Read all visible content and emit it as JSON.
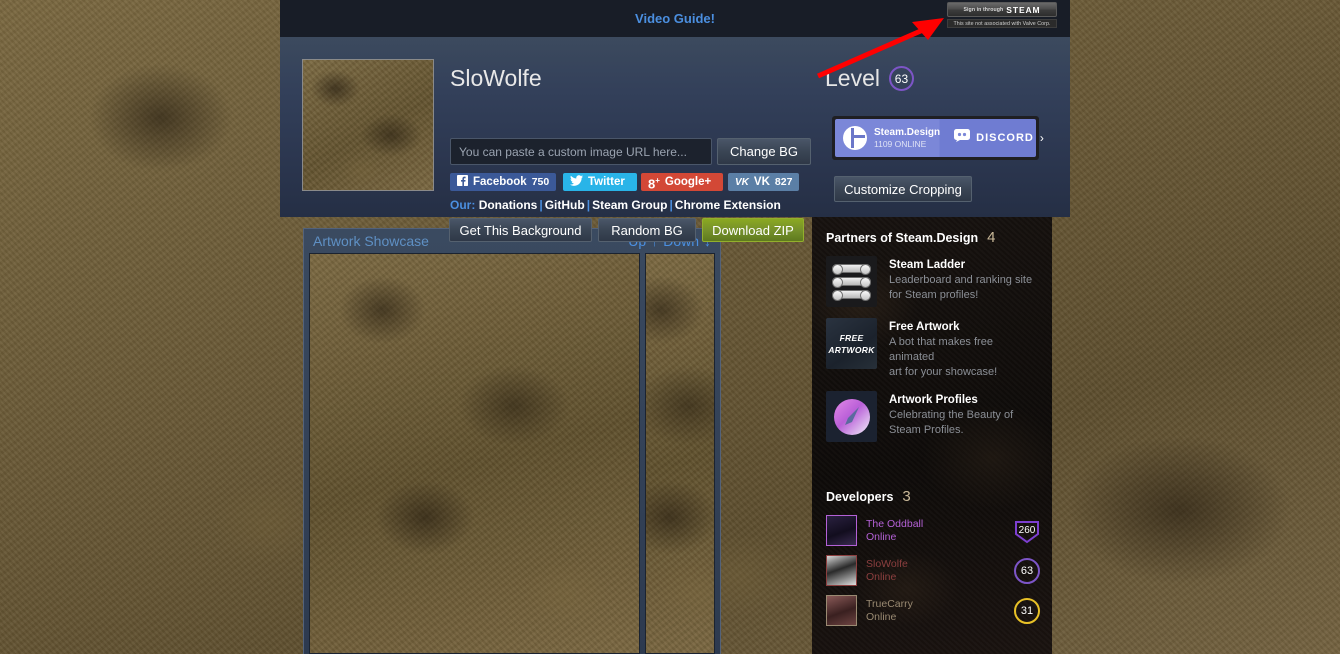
{
  "topbar": {
    "video_guide": "Video Guide!",
    "steam_signin_prefix": "Sign in through",
    "steam_signin_brand": "STEAM",
    "steam_disclaimer": "This site not associated with Valve Corp."
  },
  "profile": {
    "username": "SloWolfe",
    "bg_url_placeholder": "You can paste a custom image URL here...",
    "bg_url_value": "",
    "change_bg_label": "Change BG",
    "social": [
      {
        "name": "Facebook",
        "label": "Facebook",
        "count": "750",
        "color": "#3b5998"
      },
      {
        "name": "Twitter",
        "label": "Twitter",
        "count": "",
        "color": "#29b4e8"
      },
      {
        "name": "Google+",
        "label": "Google+",
        "count": "",
        "color": "#d34836"
      },
      {
        "name": "VK",
        "label": "VK",
        "count": "827",
        "color": "#5b7fa6"
      }
    ],
    "our_label": "Our:",
    "our_links": [
      "Donations",
      "GitHub",
      "Steam Group",
      "Chrome Extension"
    ],
    "get_background_label": "Get This Background",
    "random_bg_label": "Random BG",
    "download_zip_label": "Download ZIP",
    "level_label": "Level",
    "level_value": "63",
    "customize_cropping_label": "Customize Cropping"
  },
  "discord": {
    "server_name": "Steam.Design",
    "online_text": "1109 ONLINE",
    "brand": "DISCORD",
    "chevron": "›"
  },
  "showcase": {
    "title": "Artwork Showcase",
    "up_label": "Up",
    "up_icon": "↑",
    "down_label": "Down",
    "down_icon": "↓"
  },
  "sidebar": {
    "partners_title": "Partners of Steam.Design",
    "partners_count": "4",
    "partners": [
      {
        "icon": "steam-ladder-icon",
        "title": "Steam Ladder",
        "desc_line1": "Leaderboard and ranking site",
        "desc_line2": "for Steam profiles!"
      },
      {
        "icon": "free-artwork-icon",
        "icon_line1": "FREE",
        "icon_line2": "ARTWORK",
        "title": "Free Artwork",
        "desc_line1": "A bot that makes free animated",
        "desc_line2": "art for your showcase!"
      },
      {
        "icon": "artwork-profiles-icon",
        "title": "Artwork Profiles",
        "desc_line1": "Celebrating the Beauty of",
        "desc_line2": "Steam Profiles."
      }
    ],
    "developers_title": "Developers",
    "developers_count": "3",
    "developers": [
      {
        "name": "The Oddball",
        "status": "Online",
        "level": "260",
        "name_color": "#b461d6",
        "badge_color": "#7d3fd0",
        "badge_shape": "shield"
      },
      {
        "name": "SloWolfe",
        "status": "Online",
        "level": "63",
        "name_color": "#8c3f3f",
        "badge_color": "#7d55c7",
        "badge_shape": "circle"
      },
      {
        "name": "TrueCarry",
        "status": "Online",
        "level": "31",
        "name_color": "#9a8a72",
        "badge_color": "#e8c127",
        "badge_shape": "circle"
      }
    ]
  },
  "annotation": {
    "arrow_color": "#ff0000",
    "arrow_name": "red-pointer-arrow"
  }
}
